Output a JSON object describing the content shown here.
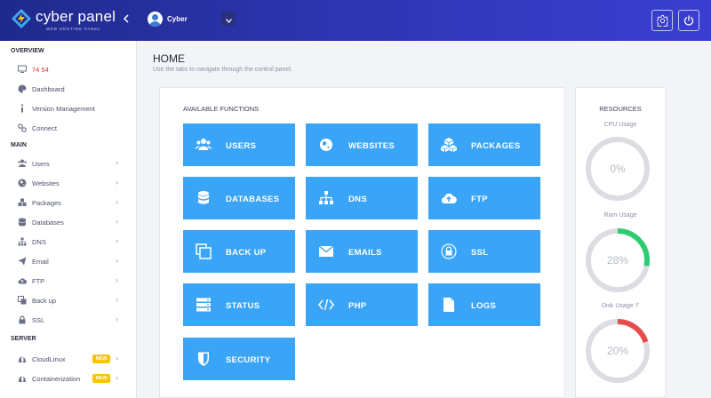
{
  "brand": {
    "name": "cyber panel",
    "sub": "WEB HOSTING PANEL"
  },
  "topbar": {
    "username": "Cyber"
  },
  "colors": {
    "accent": "#3aa4f6",
    "topbar": "#2d35b0",
    "gauge_green": "#2ecc71",
    "gauge_red": "#e74c4c",
    "gauge_track": "#dcdde2",
    "badge_new": "#f7c600"
  },
  "sidebar": {
    "overview_title": "OVERVIEW",
    "overview": [
      {
        "label": "74          54",
        "icon": "monitor-icon"
      },
      {
        "label": "Dashboard",
        "icon": "palette-icon"
      },
      {
        "label": "Version Management",
        "icon": "info-icon"
      },
      {
        "label": "Connect",
        "icon": "link-icon"
      }
    ],
    "main_title": "MAIN",
    "main": [
      {
        "label": "Users",
        "icon": "users-icon"
      },
      {
        "label": "Websites",
        "icon": "globe-icon"
      },
      {
        "label": "Packages",
        "icon": "cubes-icon"
      },
      {
        "label": "Databases",
        "icon": "database-icon"
      },
      {
        "label": "DNS",
        "icon": "sitemap-icon"
      },
      {
        "label": "Email",
        "icon": "send-icon"
      },
      {
        "label": "FTP",
        "icon": "cloud-upload-icon"
      },
      {
        "label": "Back up",
        "icon": "copy-icon"
      },
      {
        "label": "SSL",
        "icon": "lock-icon"
      }
    ],
    "server_title": "SERVER",
    "server": [
      {
        "label": "CloudLinux",
        "icon": "cloudlinux-icon",
        "badge": "NEW"
      },
      {
        "label": "Containerization",
        "icon": "container-icon",
        "badge": "NEW"
      }
    ]
  },
  "main": {
    "title": "HOME",
    "subtitle": "Use the tabs to navigate through the control panel.",
    "functions_title": "AVAILABLE FUNCTIONS",
    "functions": [
      {
        "label": "USERS",
        "icon": "users-icon"
      },
      {
        "label": "WEBSITES",
        "icon": "globe-icon"
      },
      {
        "label": "PACKAGES",
        "icon": "cubes-icon"
      },
      {
        "label": "DATABASES",
        "icon": "database-icon"
      },
      {
        "label": "DNS",
        "icon": "sitemap-icon"
      },
      {
        "label": "FTP",
        "icon": "cloud-upload-icon"
      },
      {
        "label": "BACK UP",
        "icon": "copy-icon"
      },
      {
        "label": "EMAILS",
        "icon": "envelope-icon"
      },
      {
        "label": "SSL",
        "icon": "lock-icon"
      },
      {
        "label": "STATUS",
        "icon": "server-icon"
      },
      {
        "label": "PHP",
        "icon": "code-icon"
      },
      {
        "label": "LOGS",
        "icon": "file-icon"
      },
      {
        "label": "SECURITY",
        "icon": "shield-icon"
      }
    ]
  },
  "resources": {
    "title": "RESOURCES",
    "items": [
      {
        "label": "CPU Usage",
        "value": "0%",
        "percent": 0,
        "color": "#2ecc71"
      },
      {
        "label": "Ram Usage",
        "value": "28%",
        "percent": 28,
        "color": "#2ecc71"
      },
      {
        "label": "Disk Usage '/'",
        "value": "20%",
        "percent": 20,
        "color": "#e74c4c"
      }
    ]
  }
}
